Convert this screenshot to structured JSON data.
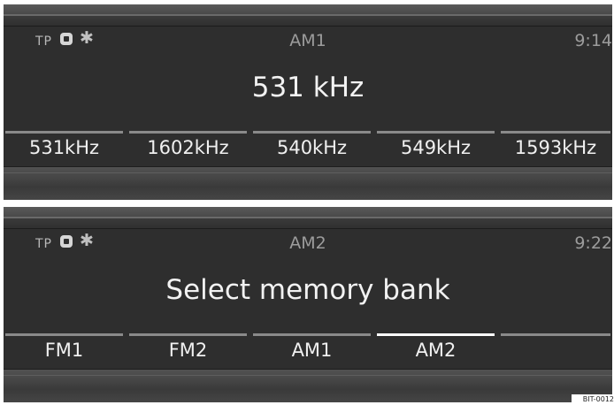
{
  "screens": [
    {
      "status": {
        "tp": "TP",
        "band": "AM1",
        "clock": "9:14"
      },
      "main_text": "531 kHz",
      "presets": [
        {
          "label": "531kHz",
          "active": false
        },
        {
          "label": "1602kHz",
          "active": false
        },
        {
          "label": "540kHz",
          "active": false
        },
        {
          "label": "549kHz",
          "active": false
        },
        {
          "label": "1593kHz",
          "active": false
        }
      ]
    },
    {
      "status": {
        "tp": "TP",
        "band": "AM2",
        "clock": "9:22"
      },
      "main_text": "Select memory bank",
      "presets": [
        {
          "label": "FM1",
          "active": false
        },
        {
          "label": "FM2",
          "active": false
        },
        {
          "label": "AM1",
          "active": false
        },
        {
          "label": "AM2",
          "active": true
        },
        {
          "label": "",
          "active": false
        }
      ]
    }
  ],
  "icons": {
    "status_1": "stop-icon",
    "status_2": "bluetooth-icon"
  },
  "colors": {
    "background": "#2e2e2e",
    "text": "#f2f2f2",
    "dim_text": "#9c9c9c",
    "active_bar": "#ffffff",
    "inactive_bar": "#8a8a8a"
  },
  "figure_code": "BIT-0012"
}
